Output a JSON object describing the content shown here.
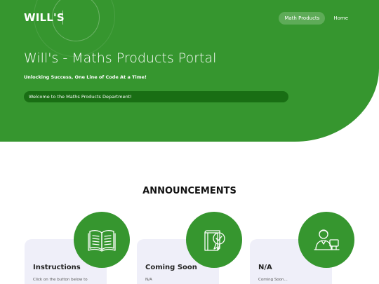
{
  "header": {
    "logo": "WILL'S",
    "nav": [
      {
        "label": "Math Products",
        "active": true
      },
      {
        "label": "Home",
        "active": false
      }
    ]
  },
  "hero": {
    "title": "Will's - Maths Products Portal",
    "subtitle": "Unlocking Success, One Line of Code At a Time!",
    "welcome": "Welcome to the Maths Products Department!"
  },
  "announcements": {
    "title": "ANNOUNCEMENTS",
    "cards": [
      {
        "title": "Instructions",
        "text": "Click on the button below to",
        "icon": "open-book-icon"
      },
      {
        "title": "Coming Soon",
        "text": "N/A",
        "icon": "book-badge-icon"
      },
      {
        "title": "N/A",
        "text": "Coming Soon...",
        "icon": "person-desk-icon"
      }
    ]
  },
  "colors": {
    "brand_green": "#36962f",
    "dark_green": "#196e14",
    "card_bg": "#efeff9"
  }
}
